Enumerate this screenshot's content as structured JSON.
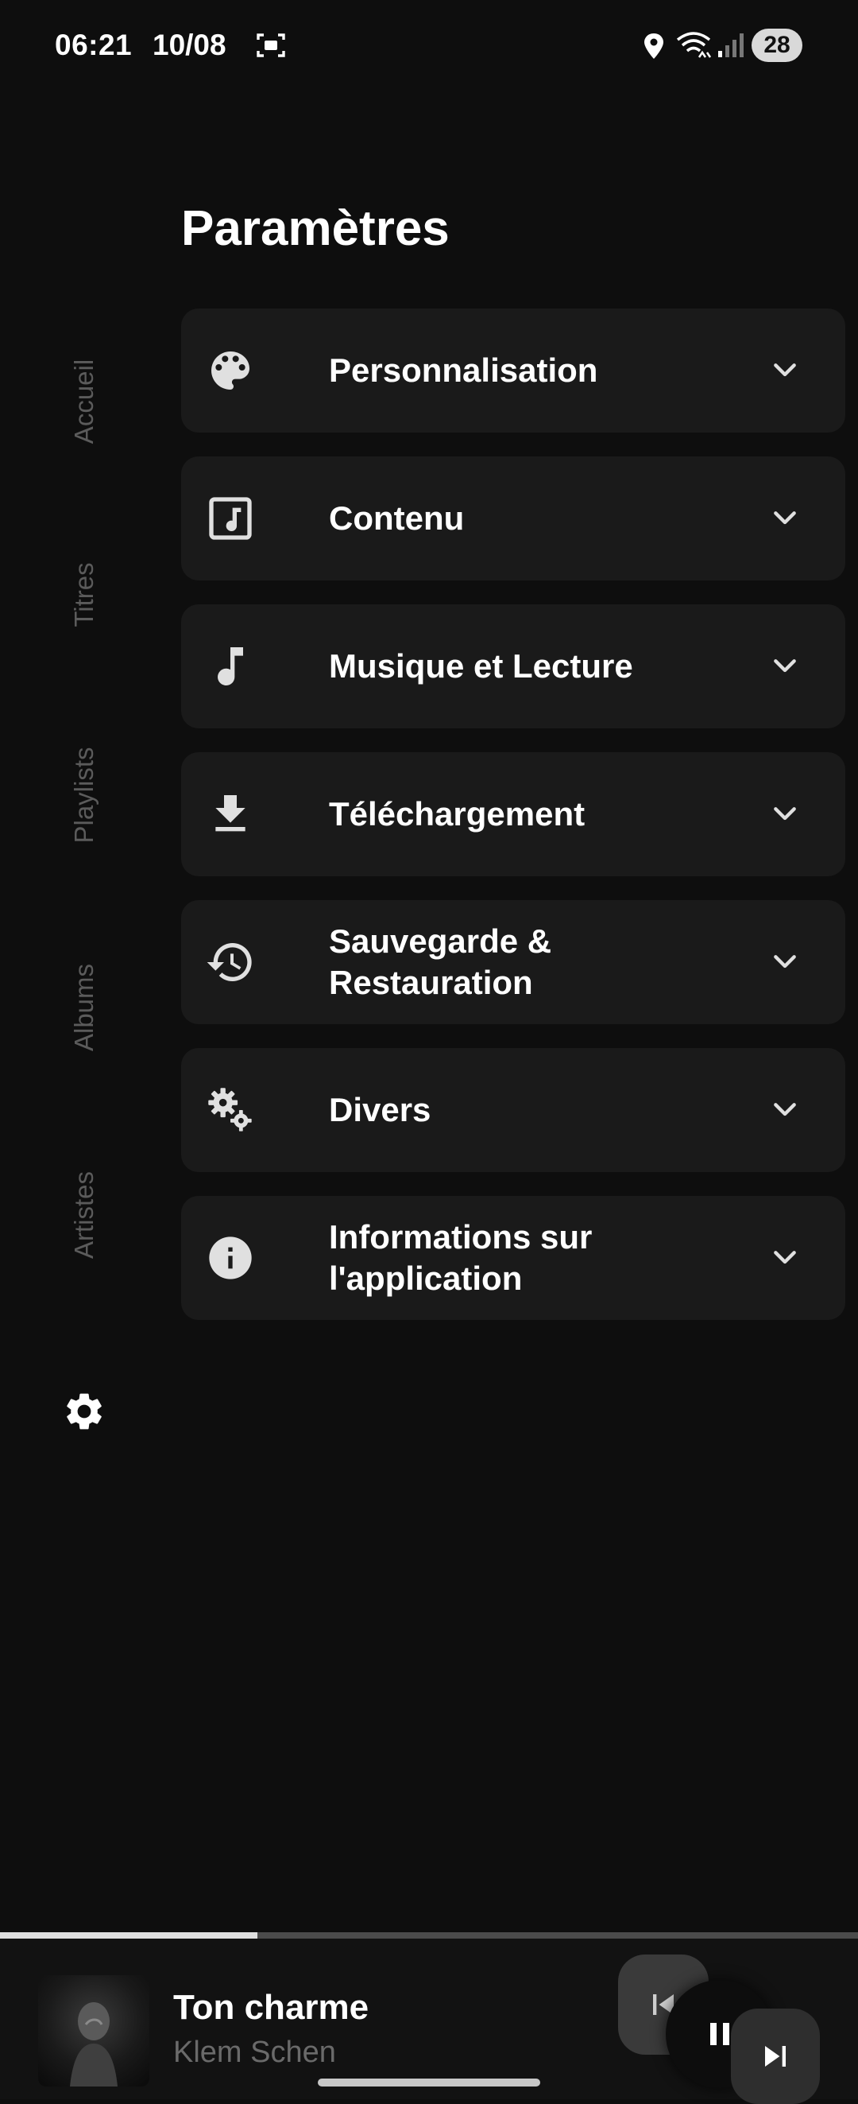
{
  "status_bar": {
    "time": "06:21",
    "date": "10/08",
    "battery": "28",
    "icons": [
      "screenshot-icon",
      "location-icon",
      "wifi-icon",
      "signal-icon"
    ]
  },
  "sidenav": {
    "items": [
      {
        "label": "Accueil"
      },
      {
        "label": "Titres"
      },
      {
        "label": "Playlists"
      },
      {
        "label": "Albums"
      },
      {
        "label": "Artistes"
      }
    ],
    "settings_icon": "gear-icon"
  },
  "page": {
    "title": "Paramètres"
  },
  "settings": [
    {
      "label": "Personnalisation",
      "icon": "palette-icon"
    },
    {
      "label": "Contenu",
      "icon": "music-box-icon"
    },
    {
      "label": "Musique et Lecture",
      "icon": "music-note-icon"
    },
    {
      "label": "Téléchargement",
      "icon": "download-icon"
    },
    {
      "label": "Sauvegarde & Restauration",
      "icon": "restore-icon"
    },
    {
      "label": "Divers",
      "icon": "gears-icon"
    },
    {
      "label": "Informations sur l'application",
      "icon": "info-icon"
    }
  ],
  "player": {
    "title": "Ton charme",
    "artist": "Klem Schen",
    "progress": 0.3
  },
  "colors": {
    "background": "#0e0e0e",
    "card": "#1a1a1a",
    "muted_text": "#5b5b5b"
  }
}
